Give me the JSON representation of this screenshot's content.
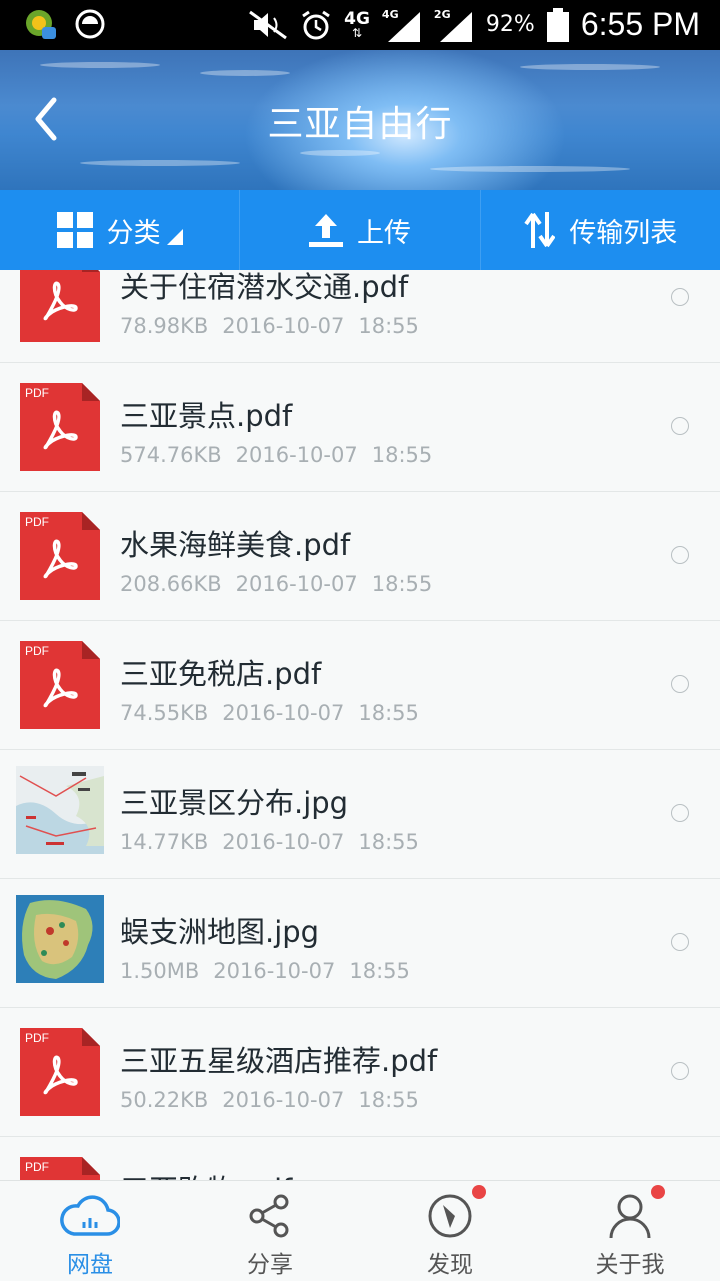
{
  "status_bar": {
    "network_4g": "4G",
    "signal_4g": "4G",
    "signal_2g": "2G",
    "battery_percent": "92%",
    "time": "6:55 PM",
    "icons": [
      "app-notification-icon",
      "sync-icon",
      "mute-icon",
      "alarm-icon",
      "signal-icon",
      "battery-icon"
    ]
  },
  "header": {
    "title": "三亚自由行",
    "back_icon": "back-chevron-icon"
  },
  "toolbar": {
    "category_label": "分类",
    "upload_label": "上传",
    "transfer_label": "传输列表"
  },
  "files": [
    {
      "name": "关于住宿潜水交通.pdf",
      "size": "78.98KB",
      "date": "2016-10-07",
      "time": "18:55",
      "type": "pdf"
    },
    {
      "name": "三亚景点.pdf",
      "size": "574.76KB",
      "date": "2016-10-07",
      "time": "18:55",
      "type": "pdf"
    },
    {
      "name": "水果海鲜美食.pdf",
      "size": "208.66KB",
      "date": "2016-10-07",
      "time": "18:55",
      "type": "pdf"
    },
    {
      "name": "三亚免税店.pdf",
      "size": "74.55KB",
      "date": "2016-10-07",
      "time": "18:55",
      "type": "pdf"
    },
    {
      "name": "三亚景区分布.jpg",
      "size": "14.77KB",
      "date": "2016-10-07",
      "time": "18:55",
      "type": "jpg-map"
    },
    {
      "name": "蜈支洲地图.jpg",
      "size": "1.50MB",
      "date": "2016-10-07",
      "time": "18:55",
      "type": "jpg-island"
    },
    {
      "name": "三亚五星级酒店推荐.pdf",
      "size": "50.22KB",
      "date": "2016-10-07",
      "time": "18:55",
      "type": "pdf"
    },
    {
      "name": "三亚购物.pdf",
      "size": "",
      "date": "",
      "time": "",
      "type": "pdf"
    }
  ],
  "pdf_badge_text": "PDF",
  "bottom_nav": {
    "items": [
      {
        "label": "网盘",
        "icon": "cloud-icon",
        "active": true
      },
      {
        "label": "分享",
        "icon": "share-icon",
        "active": false
      },
      {
        "label": "发现",
        "icon": "compass-icon",
        "active": false,
        "badge": true
      },
      {
        "label": "关于我",
        "icon": "user-icon",
        "active": false,
        "badge": true
      }
    ]
  },
  "colors": {
    "toolbar_blue": "#1d8ef0",
    "active_nav": "#2a8fe6",
    "pdf_red": "#e03535",
    "badge_red": "#e94545"
  }
}
